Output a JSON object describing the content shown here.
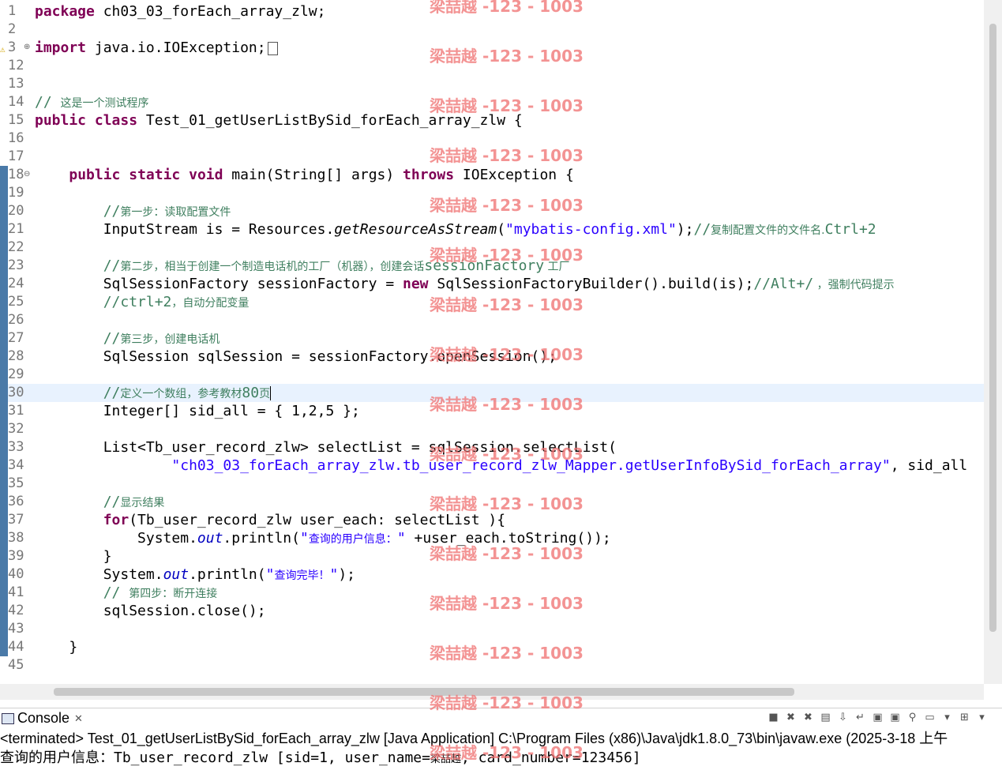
{
  "editor": {
    "lines": [
      {
        "n": "1",
        "parts": [
          {
            "t": "package",
            "c": "kw"
          },
          {
            "t": " ch03_03_forEach_array_zlw;"
          }
        ]
      },
      {
        "n": "2",
        "parts": []
      },
      {
        "n": "3",
        "parts": [
          {
            "t": "import",
            "c": "kw"
          },
          {
            "t": " java.io.IOException;"
          }
        ]
      },
      {
        "n": "12",
        "parts": []
      },
      {
        "n": "13",
        "parts": []
      },
      {
        "n": "14",
        "parts": [
          {
            "t": "// ",
            "c": "cm"
          },
          {
            "t": "这是一个测试程序",
            "c": "cm cjk"
          }
        ]
      },
      {
        "n": "15",
        "parts": [
          {
            "t": "public",
            "c": "kw"
          },
          {
            "t": " "
          },
          {
            "t": "class",
            "c": "kw"
          },
          {
            "t": " Test_01_getUserListBySid_forEach_array_zlw {"
          }
        ]
      },
      {
        "n": "16",
        "parts": []
      },
      {
        "n": "17",
        "parts": []
      },
      {
        "n": "18",
        "parts": [
          {
            "t": "    "
          },
          {
            "t": "public",
            "c": "kw"
          },
          {
            "t": " "
          },
          {
            "t": "static",
            "c": "kw"
          },
          {
            "t": " "
          },
          {
            "t": "void",
            "c": "kw"
          },
          {
            "t": " main(String[] args) "
          },
          {
            "t": "throws",
            "c": "kw"
          },
          {
            "t": " IOException {"
          }
        ]
      },
      {
        "n": "19",
        "parts": []
      },
      {
        "n": "20",
        "parts": [
          {
            "t": "        //",
            "c": "cm"
          },
          {
            "t": "第一步：读取配置文件",
            "c": "cm cjk"
          }
        ]
      },
      {
        "n": "21",
        "parts": [
          {
            "t": "        InputStream is = Resources."
          },
          {
            "t": "getResourceAsStream",
            "c": "it"
          },
          {
            "t": "("
          },
          {
            "t": "\"mybatis-config.xml\"",
            "c": "str"
          },
          {
            "t": ");"
          },
          {
            "t": "//",
            "c": "cm"
          },
          {
            "t": "复制配置文件的文件名.",
            "c": "cm cjk"
          },
          {
            "t": "Ctrl+2",
            "c": "cm"
          }
        ]
      },
      {
        "n": "22",
        "parts": []
      },
      {
        "n": "23",
        "parts": [
          {
            "t": "        //",
            "c": "cm"
          },
          {
            "t": "第二步，相当于创建一个制造电话机的工厂（机器），创建会话",
            "c": "cm cjk"
          },
          {
            "t": "sessionFactory",
            "c": "cm"
          },
          {
            "t": " 工厂",
            "c": "cm cjk"
          }
        ]
      },
      {
        "n": "24",
        "parts": [
          {
            "t": "        SqlSessionFactory sessionFactory = "
          },
          {
            "t": "new",
            "c": "kw"
          },
          {
            "t": " SqlSessionFactoryBuilder().build(is);"
          },
          {
            "t": "//Alt+/",
            "c": "cm"
          },
          {
            "t": " ，强制代码提示",
            "c": "cm cjk"
          }
        ]
      },
      {
        "n": "25",
        "parts": [
          {
            "t": "        //ctrl+2",
            "c": "cm"
          },
          {
            "t": "，自动分配变量",
            "c": "cm cjk"
          }
        ]
      },
      {
        "n": "26",
        "parts": []
      },
      {
        "n": "27",
        "parts": [
          {
            "t": "        //",
            "c": "cm"
          },
          {
            "t": "第三步，创建电话机",
            "c": "cm cjk"
          }
        ]
      },
      {
        "n": "28",
        "parts": [
          {
            "t": "        SqlSession sqlSession = sessionFactory.openSession();"
          }
        ]
      },
      {
        "n": "29",
        "parts": []
      },
      {
        "n": "30",
        "parts": [
          {
            "t": "        //",
            "c": "cm"
          },
          {
            "t": "定义一个数组，参考教材",
            "c": "cm cjk"
          },
          {
            "t": "80",
            "c": "cm"
          },
          {
            "t": "页",
            "c": "cm cjk"
          }
        ]
      },
      {
        "n": "31",
        "parts": [
          {
            "t": "        Integer[] sid_all = { 1,2,5 };"
          }
        ]
      },
      {
        "n": "32",
        "parts": []
      },
      {
        "n": "33",
        "parts": [
          {
            "t": "        List<Tb_user_record_zlw> selectList = sqlSession.selectList("
          }
        ]
      },
      {
        "n": "34",
        "parts": [
          {
            "t": "                "
          },
          {
            "t": "\"ch03_03_forEach_array_zlw.tb_user_record_zlw_Mapper.getUserInfoBySid_forEach_array\"",
            "c": "str"
          },
          {
            "t": ", sid_all"
          }
        ]
      },
      {
        "n": "35",
        "parts": []
      },
      {
        "n": "36",
        "parts": [
          {
            "t": "        //",
            "c": "cm"
          },
          {
            "t": "显示结果",
            "c": "cm cjk"
          }
        ]
      },
      {
        "n": "37",
        "parts": [
          {
            "t": "        "
          },
          {
            "t": "for",
            "c": "kw"
          },
          {
            "t": "(Tb_user_record_zlw user_each: selectList ){"
          }
        ]
      },
      {
        "n": "38",
        "parts": [
          {
            "t": "            System."
          },
          {
            "t": "out",
            "c": "fld"
          },
          {
            "t": ".println("
          },
          {
            "t": "\"",
            "c": "str"
          },
          {
            "t": "查询的用户信息：",
            "c": "str cjk"
          },
          {
            "t": "\"",
            "c": "str"
          },
          {
            "t": " +user_each.toString());"
          }
        ]
      },
      {
        "n": "39",
        "parts": [
          {
            "t": "        }"
          }
        ]
      },
      {
        "n": "40",
        "parts": [
          {
            "t": "        System."
          },
          {
            "t": "out",
            "c": "fld"
          },
          {
            "t": ".println("
          },
          {
            "t": "\"",
            "c": "str"
          },
          {
            "t": "查询完毕！",
            "c": "str cjk"
          },
          {
            "t": "\"",
            "c": "str"
          },
          {
            "t": ");"
          }
        ]
      },
      {
        "n": "41",
        "parts": [
          {
            "t": "        // ",
            "c": "cm"
          },
          {
            "t": "第四步：断开连接",
            "c": "cm cjk"
          }
        ]
      },
      {
        "n": "42",
        "parts": [
          {
            "t": "        sqlSession.close();"
          }
        ]
      },
      {
        "n": "43",
        "parts": []
      },
      {
        "n": "44",
        "parts": [
          {
            "t": "    }"
          }
        ]
      },
      {
        "n": "45",
        "parts": []
      }
    ]
  },
  "watermark": {
    "text": "梁喆越 -123 - 1003"
  },
  "console": {
    "tab_label": "Console",
    "close_glyph": "✕",
    "status": "<terminated> Test_01_getUserListBySid_forEach_array_zlw [Java Application] C:\\Program Files (x86)\\Java\\jdk1.8.0_73\\bin\\javaw.exe (2025-3-18 上午",
    "output_line1": "查询的用户信息：Tb_user_record_zlw [sid=1, user_name=",
    "output_line1_name": "梁喆越",
    "output_line1_end": ", card_number=123456]",
    "toolbar_icons": [
      "stop-icon",
      "remove-launch-icon",
      "remove-all-icon",
      "clear-console-icon",
      "scroll-lock-icon",
      "word-wrap-icon",
      "show-on-output-icon",
      "show-on-error-icon",
      "pin-console-icon",
      "display-console-icon",
      "menu-arrow-icon",
      "open-console-icon",
      "view-menu-icon"
    ]
  }
}
